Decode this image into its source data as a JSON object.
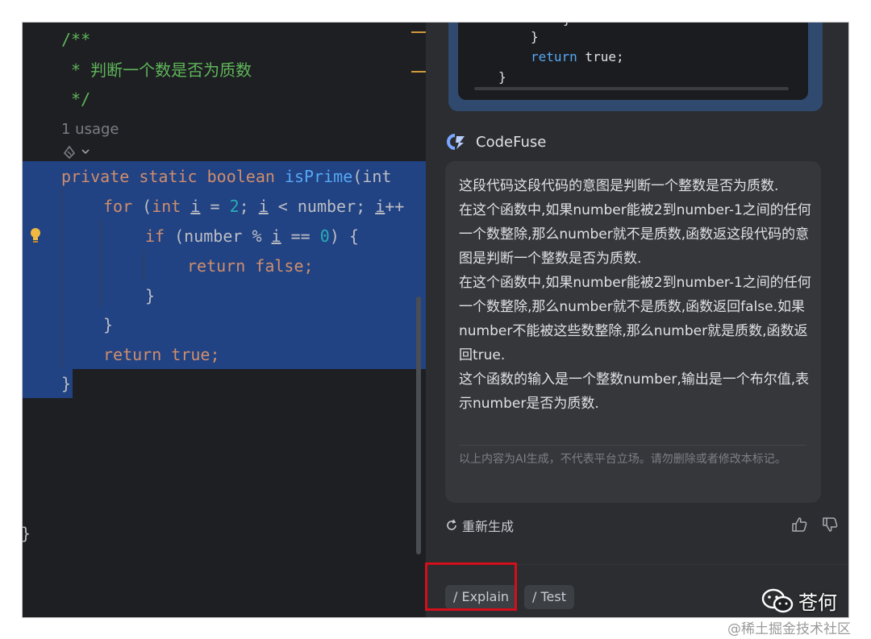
{
  "editor": {
    "comment_open": "/**",
    "comment_text": " * 判断一个数是否为质数",
    "comment_close": " */",
    "usage": "1 usage",
    "code": {
      "sig_kw": "private static boolean ",
      "sig_fn": "isPrime",
      "sig_rest": "(int",
      "for_kw": "for",
      "for_p1": " (",
      "for_int": "int",
      "for_sp": " ",
      "for_i": "i",
      "for_eq": " = ",
      "for_2": "2",
      "for_semi": "; ",
      "for_i2": "i",
      "for_cond": " < number; ",
      "for_i3": "i",
      "for_inc": "++",
      "if_kw": "if",
      "if_p1": " (number % ",
      "if_i": "i",
      "if_eq": " == ",
      "if_0": "0",
      "if_end": ") {",
      "ret_false": "return false;",
      "brace": "}",
      "ret_true": "return true;"
    }
  },
  "assistant": {
    "code_snippet": {
      "brace": "}",
      "return_kw": "return",
      "return_val": " true;",
      "close": "}"
    },
    "name": "CodeFuse",
    "message": "这段代码这段代码的意图是判断一个整数是否为质数.\n在这个函数中,如果number能被2到number-1之间的任何一个数整除,那么number就不是质数,函数返这段代码的意图是判断一个整数是否为质数.\n在这个函数中,如果number能被2到number-1之间的任何一个数整除,那么number就不是质数,函数返回false.如果number不能被这些数整除,那么number就是质数,函数返回true.\n这个函数的输入是一个整数number,输出是一个布尔值,表示number是否为质数.",
    "disclaimer": "以上内容为AI生成，不代表平台立场。请勿删除或者修改本标记。",
    "regenerate": "重新生成",
    "chips": [
      "/ Explain",
      "/ Test"
    ]
  },
  "watermark": {
    "name": "苍何",
    "site": "@稀土掘金技术社区"
  },
  "colors": {
    "selection": "#214283",
    "highlight_box": "#d20f1b",
    "comment": "#5fb65a",
    "keyword": "#cf8e6d"
  }
}
